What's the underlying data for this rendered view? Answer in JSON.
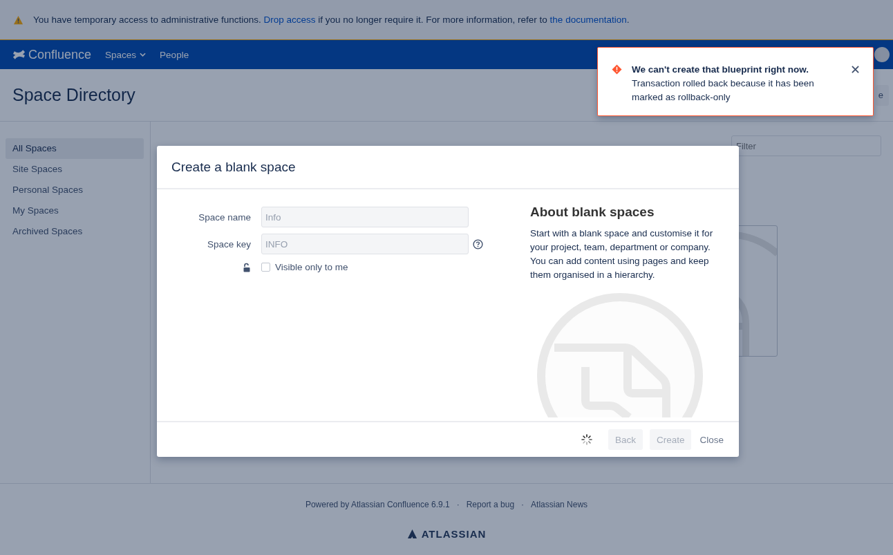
{
  "banner": {
    "text_before": "You have temporary access to administrative functions.",
    "link1": "Drop access",
    "text_middle": "if you no longer require it. For more information, refer to",
    "link2": "the documentation",
    "text_after": "."
  },
  "nav": {
    "logo": "Confluence",
    "items": [
      {
        "label": "Spaces",
        "dropdown": true
      },
      {
        "label": "People",
        "dropdown": false
      }
    ]
  },
  "header": {
    "title": "Space Directory",
    "button_fragment": "e"
  },
  "sidebar": {
    "items": [
      {
        "label": "All Spaces",
        "selected": true
      },
      {
        "label": "Site Spaces",
        "selected": false
      },
      {
        "label": "Personal Spaces",
        "selected": false
      },
      {
        "label": "My Spaces",
        "selected": false
      },
      {
        "label": "Archived Spaces",
        "selected": false
      }
    ]
  },
  "content": {
    "filter": {
      "placeholder": "Filter"
    }
  },
  "dialog": {
    "title": "Create a blank space",
    "fields": [
      {
        "label": "Space name",
        "value": "Info",
        "help": false
      },
      {
        "label": "Space key",
        "value": "INFO",
        "help": true
      }
    ],
    "visibility": {
      "label": "Visible only to me",
      "checked": false
    },
    "about": {
      "title": "About blank spaces",
      "text": "Start with a blank space and customise it for your project, team, department or company. You can add content using pages and keep them organised in a hierarchy."
    },
    "loading": true,
    "buttons": [
      {
        "label": "Back",
        "disabled": true,
        "kind": "button"
      },
      {
        "label": "Create",
        "disabled": true,
        "kind": "button"
      },
      {
        "label": "Close",
        "disabled": false,
        "kind": "link"
      }
    ]
  },
  "toast": {
    "title": "We can't create that blueprint right now.",
    "message": "Transaction rolled back because it has been marked as rollback-only"
  },
  "footer": {
    "links": [
      "Powered by Atlassian Confluence 6.9.1",
      "Report a bug",
      "Atlassian News"
    ],
    "separator": "·",
    "brand": "ATLASSIAN"
  }
}
